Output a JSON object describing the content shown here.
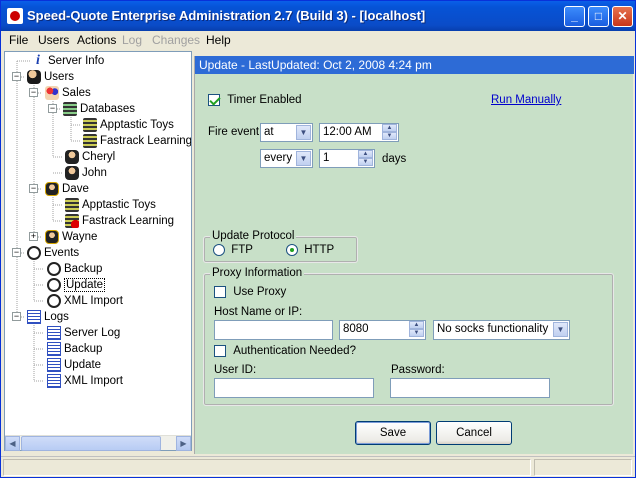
{
  "window": {
    "title": "Speed-Quote Enterprise Administration 2.7 (Build 3) - [localhost]"
  },
  "menu": [
    {
      "label": "File",
      "enabled": true
    },
    {
      "label": "Users",
      "enabled": true
    },
    {
      "label": "Actions",
      "enabled": true
    },
    {
      "label": "Log",
      "enabled": false
    },
    {
      "label": "Changes",
      "enabled": false
    },
    {
      "label": "Help",
      "enabled": true
    }
  ],
  "tree": {
    "server_info": "Server Info",
    "users": "Users",
    "sales": "Sales",
    "databases": "Databases",
    "apptastic_toys": "Apptastic Toys",
    "fastrack_learning": "Fastrack Learning",
    "cheryl": "Cheryl",
    "john": "John",
    "dave": "Dave",
    "dave_apptastic": "Apptastic Toys",
    "dave_fastrack": "Fastrack Learning",
    "wayne": "Wayne",
    "events": "Events",
    "backup": "Backup",
    "update": "Update",
    "xml_import": "XML Import",
    "logs": "Logs",
    "server_log": "Server Log",
    "log_backup": "Backup",
    "log_update": "Update",
    "log_xml_import": "XML Import"
  },
  "panel": {
    "header": "Update - LastUpdated: Oct 2, 2008 4:24 pm",
    "timer_enabled_label": "Timer Enabled",
    "timer_enabled": true,
    "run_manually": "Run Manually",
    "fire_event_label": "Fire event",
    "fire_mode": "at",
    "fire_time": "12:00 AM",
    "repeat_mode": "every",
    "repeat_value": "1",
    "repeat_unit": "days",
    "protocol": {
      "legend": "Update Protocol",
      "ftp": "FTP",
      "http": "HTTP",
      "selected": "HTTP"
    },
    "proxy": {
      "legend": "Proxy Information",
      "use_proxy_label": "Use Proxy",
      "use_proxy": false,
      "host_label": "Host Name or IP:",
      "host_value": "",
      "port_value": "8080",
      "socks": "No socks functionality",
      "auth_label": "Authentication Needed?",
      "auth": false,
      "user_label": "User ID:",
      "password_label": "Password:"
    },
    "save": "Save",
    "cancel": "Cancel"
  }
}
